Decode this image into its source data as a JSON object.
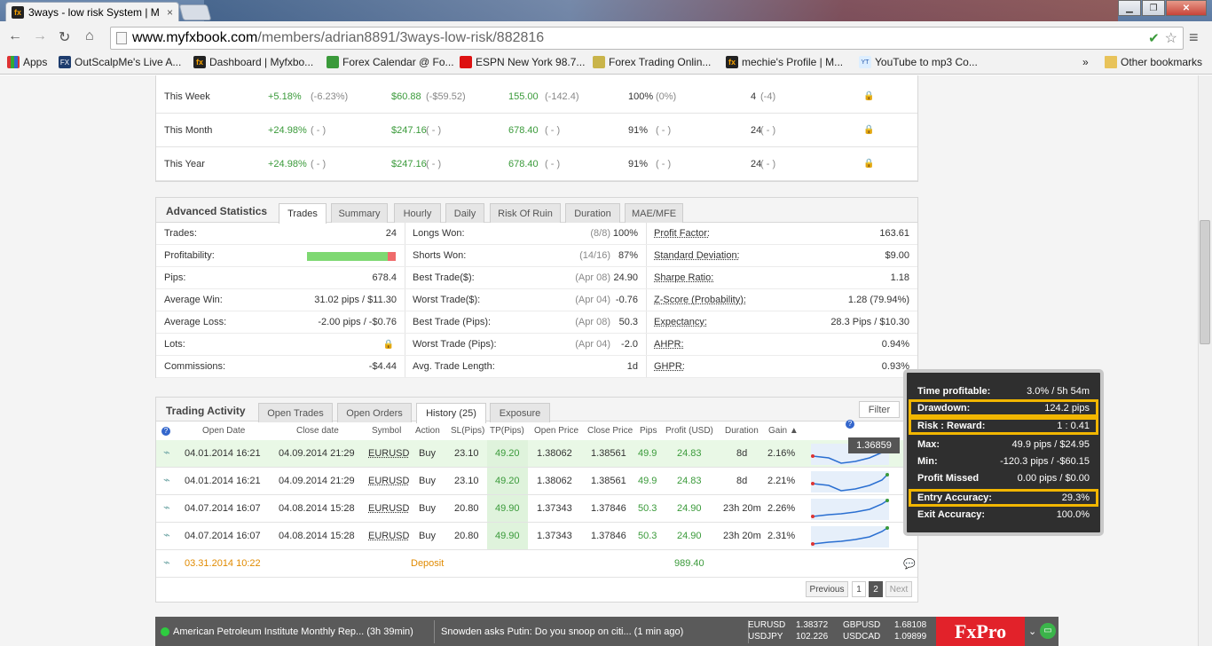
{
  "browser": {
    "tab_title": "3ways - low risk System | M",
    "tab_close": "×",
    "url_host": "www.myfxbook.com",
    "url_path": "/members/adrian8891/3ways-low-risk/882816",
    "bookmarks": [
      {
        "label": "Apps",
        "icon": "apps-grid-icon"
      },
      {
        "label": "OutScalpMe's Live A...",
        "icon": "fx-icon"
      },
      {
        "label": "Dashboard | Myfxbo...",
        "icon": "myfxbook-icon"
      },
      {
        "label": "Forex Calendar @ Fo...",
        "icon": "calendar-icon"
      },
      {
        "label": "ESPN New York 98.7...",
        "icon": "espn-icon"
      },
      {
        "label": "Forex Trading Onlin...",
        "icon": "box-icon"
      },
      {
        "label": "mechie's Profile | M...",
        "icon": "myfxbook-icon"
      },
      {
        "label": "YouTube to mp3 Co...",
        "icon": "yt-mp3-icon"
      }
    ],
    "bookmarks_more": "»",
    "other_bookmarks": "Other bookmarks"
  },
  "period_rows": [
    {
      "period": "This Week",
      "gain": "+5.18%",
      "gain2": "(-6.23%)",
      "profit": "$60.88",
      "profit2": "(-$59.52)",
      "pips": "155.00",
      "pips2": "(-142.4)",
      "won": "100%",
      "won2": "(0%)",
      "trades": "4",
      "trades2": "(-4)"
    },
    {
      "period": "This Month",
      "gain": "+24.98%",
      "gain2": "( - )",
      "profit": "$247.16",
      "profit2": "( - )",
      "pips": "678.40",
      "pips2": "( - )",
      "won": "91%",
      "won2": "( - )",
      "trades": "24",
      "trades2": "( - )"
    },
    {
      "period": "This Year",
      "gain": "+24.98%",
      "gain2": "( - )",
      "profit": "$247.16",
      "profit2": "( - )",
      "pips": "678.40",
      "pips2": "( - )",
      "won": "91%",
      "won2": "( - )",
      "trades": "24",
      "trades2": "( - )"
    }
  ],
  "advanced": {
    "title": "Advanced Statistics",
    "tabs": [
      "Trades",
      "Summary",
      "Hourly",
      "Daily",
      "Risk Of Ruin",
      "Duration",
      "MAE/MFE"
    ],
    "col1": [
      {
        "label": "Trades:",
        "value": "24"
      },
      {
        "label": "Profitability:",
        "value": ""
      },
      {
        "label": "Pips:",
        "value": "678.4"
      },
      {
        "label": "Average Win:",
        "value": "31.02 pips / $11.30"
      },
      {
        "label": "Average Loss:",
        "value": "-2.00 pips / -$0.76"
      },
      {
        "label": "Lots:",
        "value": ""
      },
      {
        "label": "Commissions:",
        "value": "-$4.44"
      }
    ],
    "profitability_fraction": 0.91,
    "col2": [
      {
        "label": "Longs Won:",
        "note": "(8/8)",
        "value": "100%"
      },
      {
        "label": "Shorts Won:",
        "note": "(14/16)",
        "value": "87%"
      },
      {
        "label": "Best Trade($):",
        "note": "(Apr 08)",
        "value": "24.90"
      },
      {
        "label": "Worst Trade($):",
        "note": "(Apr 04)",
        "value": "-0.76"
      },
      {
        "label": "Best Trade (Pips):",
        "note": "(Apr 08)",
        "value": "50.3"
      },
      {
        "label": "Worst Trade (Pips):",
        "note": "(Apr 04)",
        "value": "-2.0"
      },
      {
        "label": "Avg. Trade Length:",
        "note": "",
        "value": "1d"
      }
    ],
    "col3": [
      {
        "label": "Profit Factor:",
        "value": "163.61"
      },
      {
        "label": "Standard Deviation:",
        "value": "$9.00"
      },
      {
        "label": "Sharpe Ratio:",
        "value": "1.18"
      },
      {
        "label": "Z-Score (Probability):",
        "value": "1.28 (79.94%)"
      },
      {
        "label": "Expectancy:",
        "value": "28.3 Pips / $10.30"
      },
      {
        "label": "AHPR:",
        "value": "0.94%"
      },
      {
        "label": "GHPR:",
        "value": "0.93%"
      }
    ]
  },
  "activity": {
    "title": "Trading Activity",
    "tabs": [
      "Open Trades",
      "Open Orders",
      "History (25)",
      "Exposure"
    ],
    "filter": "Filter",
    "help": "?",
    "headers": [
      "Open Date",
      "Close date",
      "Symbol",
      "Action",
      "SL(Pips)",
      "TP(Pips)",
      "Open Price",
      "Close Price",
      "Pips",
      "Profit (USD)",
      "Duration",
      "Gain"
    ],
    "rows": [
      {
        "open": "04.01.2014 16:21",
        "close": "04.09.2014 21:29",
        "symbol": "EURUSD",
        "action": "Buy",
        "sl": "23.10",
        "tp": "49.20",
        "op": "1.38062",
        "cp": "1.38561",
        "pips": "49.9",
        "profit": "24.83",
        "dur": "8d",
        "gain": "2.16%"
      },
      {
        "open": "04.01.2014 16:21",
        "close": "04.09.2014 21:29",
        "symbol": "EURUSD",
        "action": "Buy",
        "sl": "23.10",
        "tp": "49.20",
        "op": "1.38062",
        "cp": "1.38561",
        "pips": "49.9",
        "profit": "24.83",
        "dur": "8d",
        "gain": "2.21%"
      },
      {
        "open": "04.07.2014 16:07",
        "close": "04.08.2014 15:28",
        "symbol": "EURUSD",
        "action": "Buy",
        "sl": "20.80",
        "tp": "49.90",
        "op": "1.37343",
        "cp": "1.37846",
        "pips": "50.3",
        "profit": "24.90",
        "dur": "23h 20m",
        "gain": "2.26%"
      },
      {
        "open": "04.07.2014 16:07",
        "close": "04.08.2014 15:28",
        "symbol": "EURUSD",
        "action": "Buy",
        "sl": "20.80",
        "tp": "49.90",
        "op": "1.37343",
        "cp": "1.37846",
        "pips": "50.3",
        "profit": "24.90",
        "dur": "23h 20m",
        "gain": "2.31%"
      }
    ],
    "deposit": {
      "date": "03.31.2014 10:22",
      "label": "Deposit",
      "amount": "989.40"
    },
    "price_tag": "1.36859",
    "pagination": {
      "prev": "Previous",
      "p1": "1",
      "p2": "2",
      "next": "Next"
    }
  },
  "tooltip": {
    "rows": [
      {
        "label": "Time profitable:",
        "value": "3.0% / 5h 54m"
      },
      {
        "label": "Drawdown:",
        "value": "124.2 pips"
      },
      {
        "label": "Risk : Reward:",
        "value": "1 : 0.41"
      },
      {
        "label": "Max:",
        "value": "49.9 pips / $24.95"
      },
      {
        "label": "Min:",
        "value": "-120.3 pips / -$60.15"
      },
      {
        "label": "Profit Missed",
        "value": "0.00 pips / $0.00"
      },
      {
        "label": "Entry Accuracy:",
        "value": "29.3%"
      },
      {
        "label": "Exit Accuracy:",
        "value": "100.0%"
      }
    ],
    "highlight_color": "#f2b600"
  },
  "ticker": {
    "news1": "American Petroleum Institute Monthly Rep... (3h 39min)",
    "news2": "Snowden asks Putin: Do you snoop on citi... (1 min ago)",
    "q": [
      {
        "sym": "EURUSD",
        "px": "1.38372"
      },
      {
        "sym": "USDJPY",
        "px": "102.226"
      },
      {
        "sym": "GBPUSD",
        "px": "1.68108"
      },
      {
        "sym": "USDCAD",
        "px": "1.09899"
      }
    ],
    "brand": "FxPro"
  },
  "colors": {
    "green": "#3a9a3a",
    "accent": "#f2b600",
    "fxpro": "#e2222a"
  }
}
